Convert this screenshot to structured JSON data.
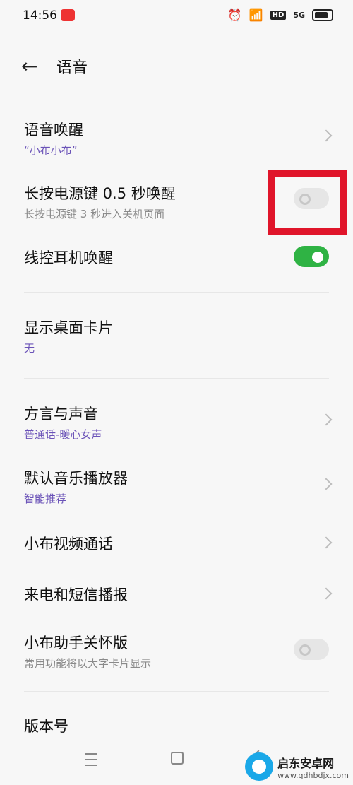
{
  "status": {
    "time": "14:56",
    "signal": "5G"
  },
  "header": {
    "title": "语音"
  },
  "items": [
    {
      "label": "语音唤醒",
      "sub": "“小布小布”"
    },
    {
      "label": "长按电源键 0.5 秒唤醒",
      "sub": "长按电源键 3 秒进入关机页面"
    },
    {
      "label": "线控耳机唤醒"
    },
    {
      "label": "显示桌面卡片",
      "sub": "无"
    },
    {
      "label": "方言与声音",
      "sub": "普通话-暖心女声"
    },
    {
      "label": "默认音乐播放器",
      "sub": "智能推荐"
    },
    {
      "label": "小布视频通话"
    },
    {
      "label": "来电和短信播报"
    },
    {
      "label": "小布助手关怀版",
      "sub": "常用功能将以大字卡片显示"
    },
    {
      "label": "版本号"
    }
  ],
  "toggles": {
    "power_key": false,
    "headset": true,
    "care": false
  },
  "watermark": {
    "title": "启东安卓网",
    "url": "www.qdhbdjx.com"
  },
  "colors": {
    "accent": "#6b53b8",
    "toggle_on": "#2fb344",
    "highlight": "#e0152a"
  }
}
